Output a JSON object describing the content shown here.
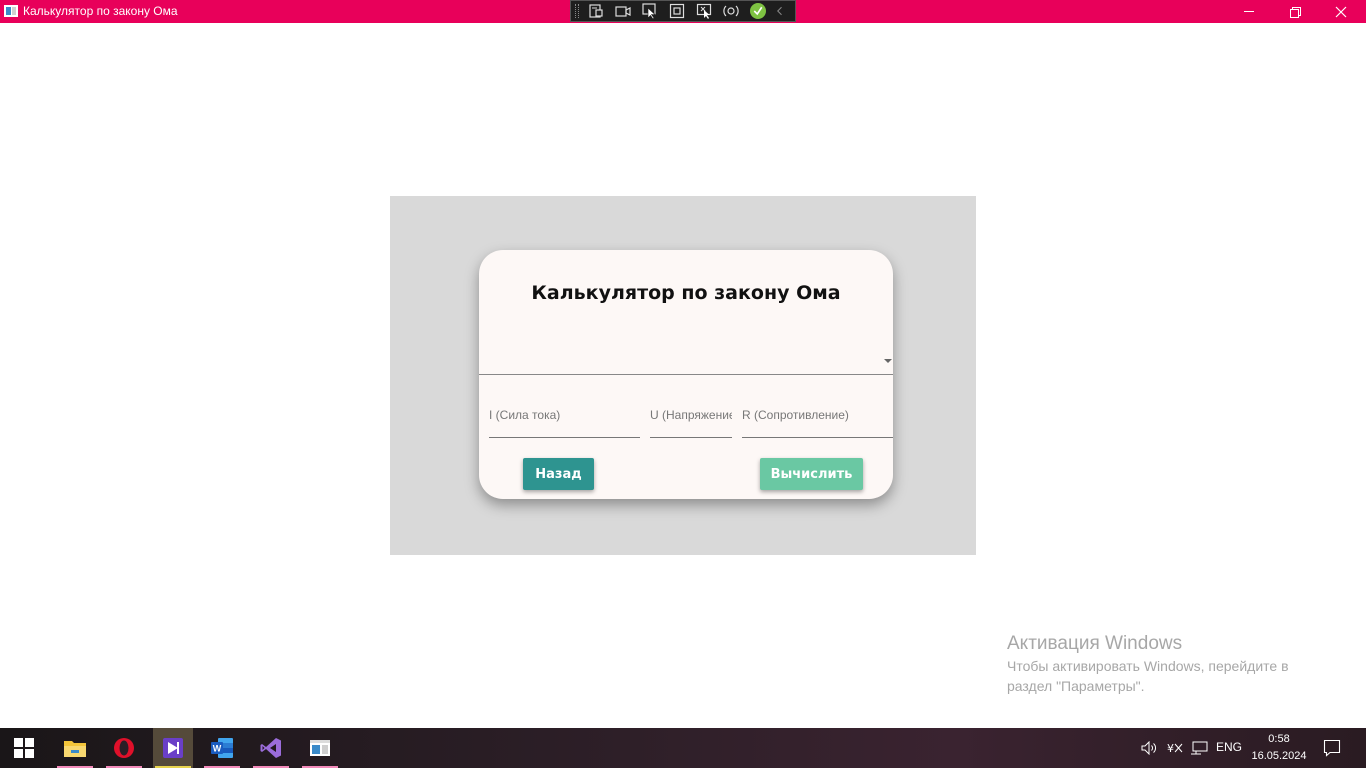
{
  "window": {
    "title": "Калькулятор по закону Ома",
    "accent_color": "#e8005a"
  },
  "debug_toolbar": {
    "icons": [
      "live-visual-tree-icon",
      "record-icon",
      "select-element-icon",
      "display-layout-adorners-icon",
      "track-focus-icon",
      "hot-reload-icon",
      "xaml-binding-ok-icon",
      "collapse-arrow-icon"
    ]
  },
  "card": {
    "title": "Калькулятор по закону Ома",
    "combo_value": "",
    "fields": {
      "current_placeholder": "I (Сила тока)",
      "voltage_placeholder": "U (Напряжение)",
      "resistance_placeholder": "R (Сопротивление)"
    },
    "back_label": "Назад",
    "calculate_label": "Вычислить",
    "colors": {
      "back": "#2e9490",
      "calculate": "#6ac8a3",
      "panel": "#d9d9d9",
      "card": "#fdf8f6"
    }
  },
  "activation": {
    "title": "Активация Windows",
    "text": "Чтобы активировать Windows, перейдите в раздел \"Параметры\"."
  },
  "taskbar": {
    "apps": [
      "start-icon",
      "file-explorer-icon",
      "opera-icon",
      "visual-studio-installer-icon",
      "word-icon",
      "visual-studio-icon",
      "wpf-app-icon"
    ],
    "language": "ENG",
    "time": "0:58",
    "date": "16.05.2024"
  }
}
